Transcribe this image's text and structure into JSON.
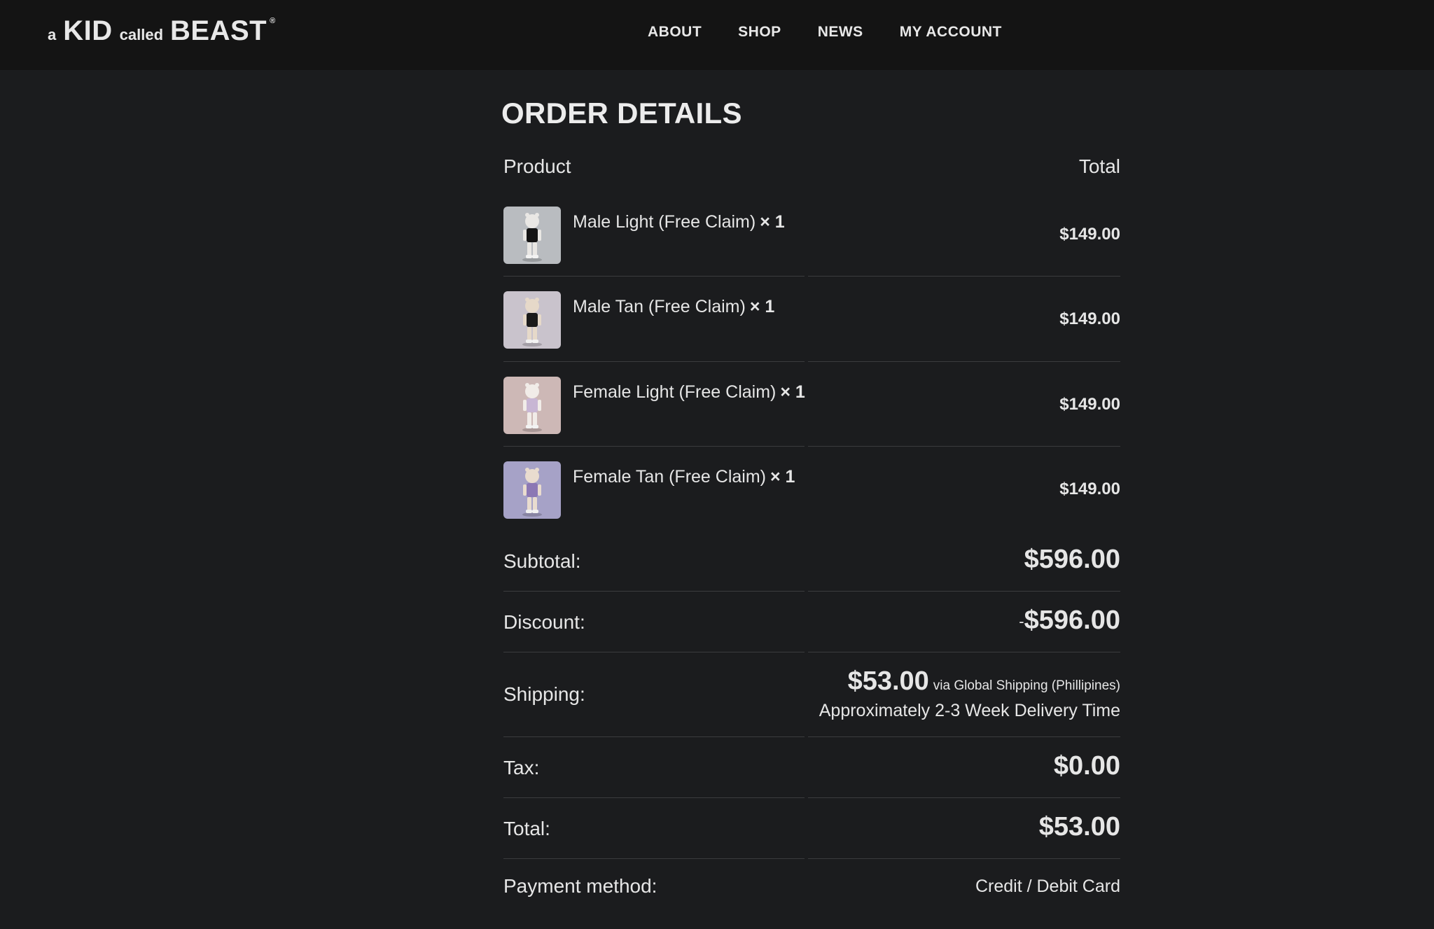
{
  "brand": {
    "prefix": "a",
    "kid": "KID",
    "called": "called",
    "beast": "BEAST",
    "registered": "®"
  },
  "nav": [
    {
      "label": "ABOUT"
    },
    {
      "label": "SHOP"
    },
    {
      "label": "NEWS"
    },
    {
      "label": "MY ACCOUNT"
    }
  ],
  "order": {
    "title": "ORDER DETAILS",
    "headers": {
      "product": "Product",
      "total": "Total"
    },
    "items": [
      {
        "name": "Male Light (Free Claim)",
        "qty": "× 1",
        "price": "$149.00",
        "bg": "#b9bcc0",
        "skin": "#e9e7e4",
        "outfit": "#141414"
      },
      {
        "name": "Male Tan (Free Claim)",
        "qty": "× 1",
        "price": "$149.00",
        "bg": "#c9c3cc",
        "skin": "#e6d9c9",
        "outfit": "#1a1a1a"
      },
      {
        "name": "Female Light (Free Claim)",
        "qty": "× 1",
        "price": "$149.00",
        "bg": "#cdb8b6",
        "skin": "#f1ece8",
        "outfit": "#c8b6d4"
      },
      {
        "name": "Female Tan (Free Claim)",
        "qty": "× 1",
        "price": "$149.00",
        "bg": "#a6a2c7",
        "skin": "#e9dccf",
        "outfit": "#8c78b4"
      }
    ],
    "totals": {
      "subtotal_label": "Subtotal:",
      "subtotal_value": "$596.00",
      "discount_label": "Discount:",
      "discount_sign": "-",
      "discount_value": "$596.00",
      "shipping_label": "Shipping:",
      "shipping_value": "$53.00",
      "shipping_via": "via Global Shipping (Phillipines)",
      "shipping_time": "Approximately 2-3 Week Delivery Time",
      "tax_label": "Tax:",
      "tax_value": "$0.00",
      "total_label": "Total:",
      "total_value": "$53.00",
      "payment_label": "Payment method:",
      "payment_value": "Credit / Debit Card"
    }
  }
}
